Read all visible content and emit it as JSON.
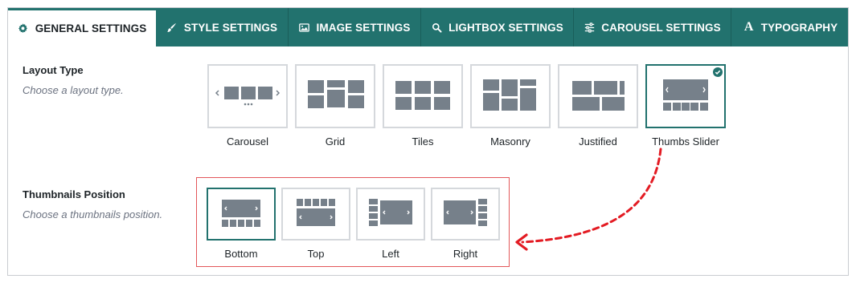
{
  "tabs": [
    {
      "label": "GENERAL SETTINGS",
      "icon": "gear-icon",
      "active": true
    },
    {
      "label": "STYLE SETTINGS",
      "icon": "brush-icon",
      "active": false
    },
    {
      "label": "IMAGE SETTINGS",
      "icon": "image-icon",
      "active": false
    },
    {
      "label": "LIGHTBOX SETTINGS",
      "icon": "search-icon",
      "active": false
    },
    {
      "label": "CAROUSEL SETTINGS",
      "icon": "sliders-icon",
      "active": false
    },
    {
      "label": "TYPOGRAPHY",
      "icon": "typography-icon",
      "active": false
    }
  ],
  "layout": {
    "label": "Layout Type",
    "description": "Choose a layout type.",
    "options": [
      {
        "label": "Carousel",
        "selected": false
      },
      {
        "label": "Grid",
        "selected": false
      },
      {
        "label": "Tiles",
        "selected": false
      },
      {
        "label": "Masonry",
        "selected": false
      },
      {
        "label": "Justified",
        "selected": false
      },
      {
        "label": "Thumbs Slider",
        "selected": true
      }
    ]
  },
  "thumbs": {
    "label": "Thumbnails Position",
    "description": "Choose a thumbnails position.",
    "options": [
      {
        "label": "Bottom",
        "selected": true
      },
      {
        "label": "Top",
        "selected": false
      },
      {
        "label": "Left",
        "selected": false
      },
      {
        "label": "Right",
        "selected": false
      }
    ]
  },
  "colors": {
    "accent": "#22726e",
    "placeholder": "#76808a",
    "highlight_box": "#e3575a",
    "arrow": "#e31b23"
  }
}
